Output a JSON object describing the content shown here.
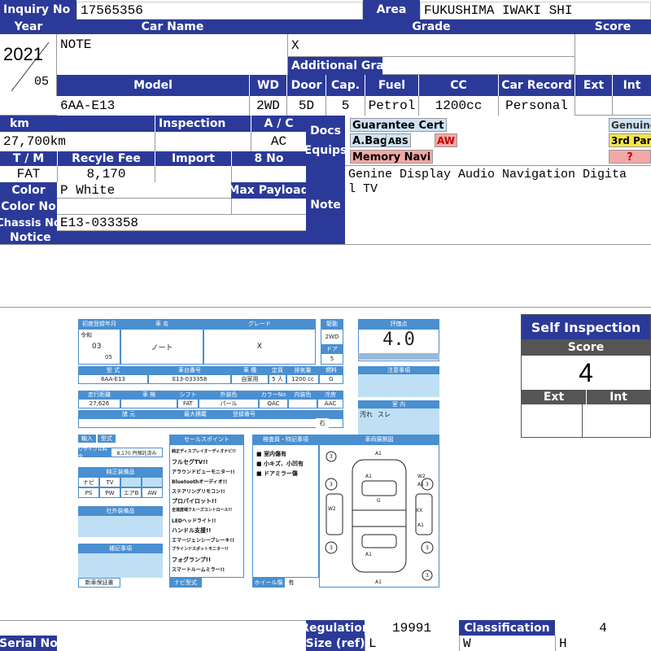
{
  "header": {
    "inquiry_label": "Inquiry No",
    "inquiry_value": "17565356",
    "area_label": "Area",
    "area_value": "FUKUSHIMA IWAKI SHI",
    "year_label": "Year",
    "year_value": "2021",
    "month_value": "05",
    "carname_label": "Car Name",
    "carname_value": "NOTE",
    "grade_label": "Grade",
    "grade_value": "X",
    "addgrade_label": "Additional Grade",
    "score_label": "Score"
  },
  "specs": {
    "model_label": "Model",
    "model_value": "6AA-E13",
    "wd_label": "WD",
    "wd_value": "2WD",
    "door_label": "Door",
    "door_value": "5D",
    "cap_label": "Cap.",
    "cap_value": "5",
    "fuel_label": "Fuel",
    "fuel_value": "Petrol",
    "cc_label": "CC",
    "cc_value": "1200cc",
    "record_label": "Car Record",
    "record_value": "Personal",
    "ext_label": "Ext",
    "int_label": "Int"
  },
  "details": {
    "km_label": "km",
    "km_value": "27,700km",
    "inspection_label": "Inspection",
    "ac_label": "A / C",
    "ac_value": "AC",
    "docs_label": "Docs",
    "equips_label": "Equips",
    "tm_label": "T / M",
    "tm_value": "FAT",
    "recycle_label": "Recyle Fee",
    "recycle_value": "8,170",
    "import_label": "Import",
    "eightno_label": "8 No",
    "color_label": "Color",
    "color_value": "P White",
    "payload_label": "Max Payload",
    "colorno_label": "Color No",
    "chassis_label": "Chassis No",
    "chassis_value": "E13-033358",
    "notice_label": "Notice",
    "note_label": "Note",
    "note_value_1": "Genine Display Audio Navigation Digita",
    "note_value_2": "l TV"
  },
  "tags": {
    "guarantee": "Guarantee Cert",
    "abag": "A.Bag",
    "abs": "ABS",
    "aw": "AW",
    "memory_navi": "Memory Navi",
    "genuine": "Genuine",
    "third_party": "3rd Party",
    "question": "?"
  },
  "self_inspection": {
    "title": "Self Inspection",
    "score_label": "Score",
    "score_value": "4",
    "ext_label": "Ext",
    "int_label": "Int"
  },
  "footer": {
    "regulation_label": "Regulation",
    "regulation_value": "19991",
    "classification_label": "Classification",
    "classification_value": "4",
    "serial_label": "Serial No",
    "size_label": "Size (ref)",
    "l_label": "L",
    "w_label": "W",
    "h_label": "H"
  },
  "sheet": {
    "first_reg": "初度登録年月",
    "car_name_h": "車 名",
    "grade_h": "グレード",
    "drive_h": "駆動",
    "eval_h": "評価点",
    "era": "令和",
    "year": "03",
    "month": "05",
    "car_name": "ノート",
    "grade": "X",
    "drive": "2WD",
    "door_h": "ドア",
    "door": "5",
    "eval_score": "4.0",
    "type_h": "型 式",
    "chassis_h": "車台番号",
    "kind_h": "車 種",
    "cap_h": "定員",
    "disp_h": "排気量",
    "fuel_h": "燃料",
    "type": "6AA-E13",
    "chassis": "E13-033358",
    "kind": "自家用",
    "cap": "5 人",
    "disp": "1200 cc",
    "fuel": "G",
    "caution_h": "注意事項",
    "km_h": "走行距離",
    "insp_h": "車 検",
    "shift_h": "シフト",
    "color_h": "外装色",
    "colorno_h": "カラーNo",
    "int_color_h": "内装色",
    "ac_h": "冷房",
    "km": "27,626",
    "shift": "FAT",
    "color": "パール",
    "colorno": "QAC",
    "ac": "AAC",
    "interior_h": "室 内",
    "price_h": "諸 元",
    "maxload_h": "最大積載",
    "regno_h": "登録番号",
    "steering": "右",
    "stain": "汚れ",
    "scratch": "スレ",
    "import_h": "輸入",
    "model_h": "型式",
    "recycle": "リサイクル料金",
    "recycle_val": "8,170 円預託済み",
    "genuine_h": "純正装備品",
    "eq": [
      "ナビ",
      "TV",
      "AW",
      "PS",
      "PW",
      "エアB",
      "AW"
    ],
    "aftermarket_h": "社外装備品",
    "supplement_h": "補記事項",
    "new_warranty": "新車保証書",
    "sales_h": "セールスポイント",
    "sales": [
      "純正ディスプレイオーディオナビ!!",
      "フルセグTV!!",
      "アラウンドビューモニター!!",
      "Bluetoothオーディオ!!",
      "ステアリングリモコン!!",
      "プロパイロット!!",
      "全速度域クルーズコントロール!!",
      "LEDヘッドライト!!",
      "ハンドル支援!!",
      "エマージェンシーブレーキ!!",
      "ブラインドスポットモニター!!",
      "フォグランプ!!",
      "スマートルームミラー!!"
    ],
    "navi_h": "ナビ型式",
    "inspector_h": "検査員・特記事項",
    "inspector": [
      "室内傷有",
      "小キズ、小凹有",
      "ドアミラー傷"
    ],
    "wheel_h": "ホイール傷",
    "wheel_val": "有",
    "diagram_h": "車両展開図",
    "marks": [
      "A1",
      "A1",
      "W2",
      "A1",
      "G",
      "W2",
      "XX",
      "A1",
      "A1",
      "A1",
      "3",
      "3",
      "3",
      "3",
      "3",
      "3"
    ]
  }
}
